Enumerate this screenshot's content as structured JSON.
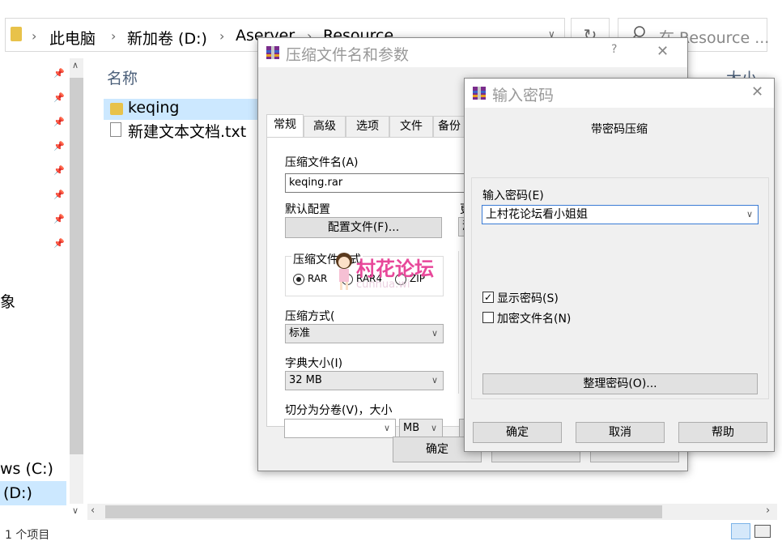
{
  "explorer": {
    "breadcrumb": [
      "此电脑",
      "新加卷 (D:)",
      "Aserver",
      "Resource"
    ],
    "search_placeholder": "在 Resource ...",
    "col_name": "名称",
    "col_size": "大小",
    "files": [
      {
        "name": "keqing",
        "type": "folder"
      },
      {
        "name": "新建文本文档.txt",
        "type": "text"
      }
    ],
    "nav_fragment": "象",
    "drive_c": "ws (C:)",
    "drive_d": "(D:)",
    "status": "1 个项目"
  },
  "archive_dialog": {
    "title": "压缩文件名和参数",
    "help_char": "?",
    "tabs": [
      "常规",
      "高级",
      "选项",
      "文件",
      "备份"
    ],
    "archive_name_label": "压缩文件名(A)",
    "archive_name_value": "keqing.rar",
    "default_profile_label": "默认配置",
    "profile_button": "配置文件(F)...",
    "right_frag_1": "更",
    "right_frag_2": "添",
    "format_group": "压缩文件格式",
    "formats": [
      "RAR",
      "RAR4",
      "ZIP"
    ],
    "method_label": "压缩方式(",
    "method_value": "标准",
    "dict_label": "字典大小(I)",
    "dict_value": "32 MB",
    "split_label": "切分为分卷(V)，大小",
    "split_unit": "MB",
    "ok_button": "确定"
  },
  "watermark": {
    "text": "村花论坛",
    "sub": "cunhua.wi"
  },
  "password_dialog": {
    "title": "输入密码",
    "heading": "带密码压缩",
    "password_label": "输入密码(E)",
    "password_value": "上村花论坛看小姐姐",
    "show_password": "显示密码(S)",
    "show_password_checked": true,
    "encrypt_names": "加密文件名(N)",
    "encrypt_names_checked": false,
    "organize_button": "整理密码(O)...",
    "ok_button": "确定",
    "cancel_button": "取消",
    "help_button": "帮助"
  },
  "colors": {
    "selection": "#cce8ff",
    "watermark_pink": "#e8489a"
  }
}
